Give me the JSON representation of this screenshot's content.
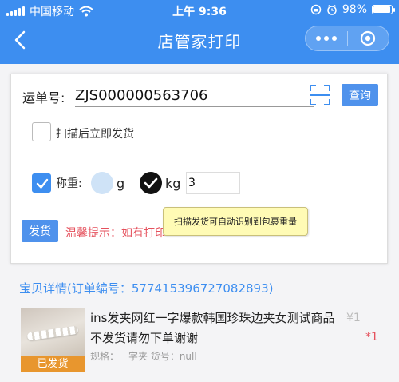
{
  "status_bar": {
    "carrier": "中国移动",
    "time": "上午 9:36",
    "battery": "98%"
  },
  "nav": {
    "title": "店管家打印"
  },
  "form": {
    "waybill_label": "运单号:",
    "waybill_value": "ZJS000000563706",
    "query_label": "查询",
    "ship_after_scan_label": "扫描后立即发货",
    "weigh_label": "称重:",
    "unit_g": "g",
    "unit_kg": "kg",
    "weight_value": "3",
    "ship_label": "发货",
    "tip": "温馨提示：如有打印",
    "tooltip": "扫描发货可自动识别到包裹重量"
  },
  "goods": {
    "detail_title": "宝贝详情(订单编号：577415396727082893)",
    "badge": "已发货",
    "name": "ins发夹网红一字爆款韩国珍珠边夹女测试商品不发货请勿下单谢谢",
    "spec": "规格：一字夹 货号：null",
    "price": "¥1",
    "qty": "*1"
  }
}
